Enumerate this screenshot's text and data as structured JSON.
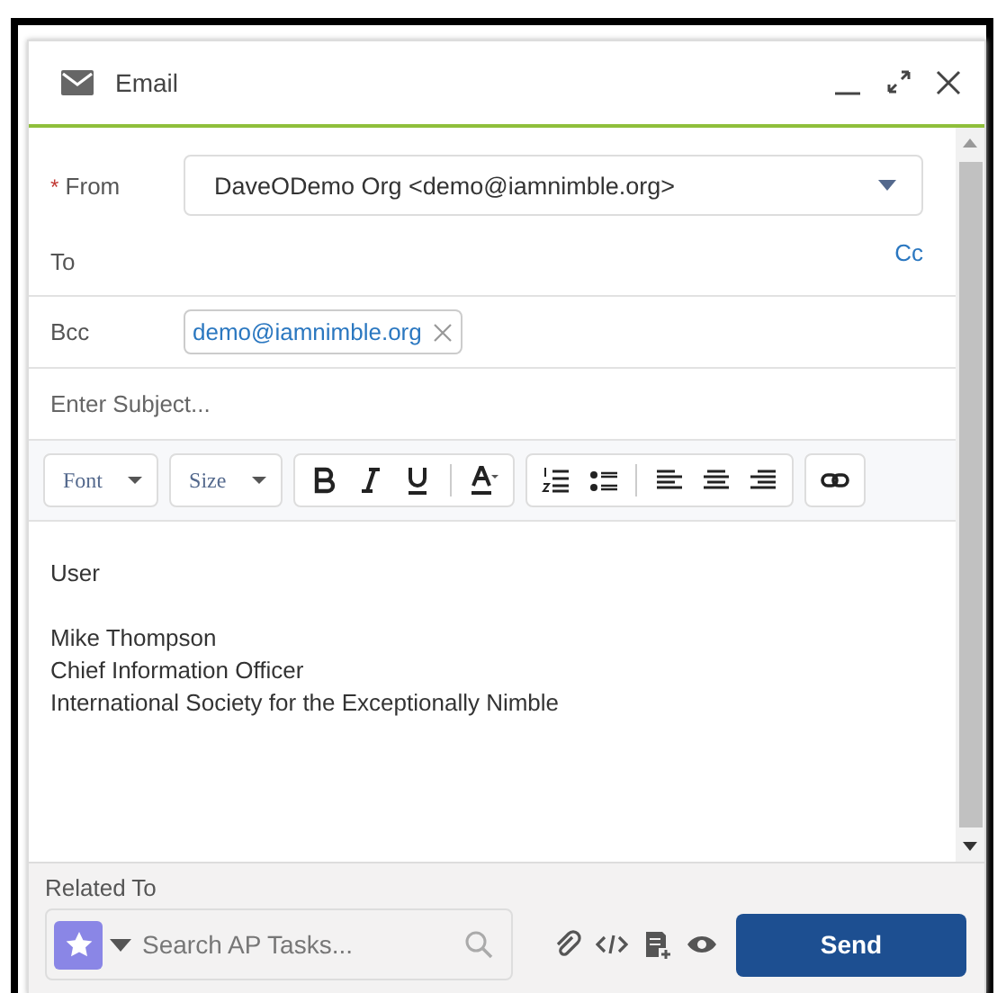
{
  "window": {
    "title": "Email"
  },
  "from": {
    "label": "From",
    "required": true,
    "required_mark": "*",
    "value": "DaveODemo Org <demo@iamnimble.org>"
  },
  "to": {
    "label": "To",
    "cc": "Cc"
  },
  "bcc": {
    "label": "Bcc",
    "recipients": [
      "demo@iamnimble.org"
    ]
  },
  "subject": {
    "placeholder": "Enter Subject..."
  },
  "toolbar": {
    "font": "Font",
    "size": "Size"
  },
  "body": [
    [
      "User"
    ],
    [
      "Mike Thompson",
      "Chief Information Officer",
      "International Society for the Exceptionally Nimble"
    ]
  ],
  "related": {
    "label": "Related To",
    "placeholder": "Search AP Tasks..."
  },
  "send": "Send"
}
